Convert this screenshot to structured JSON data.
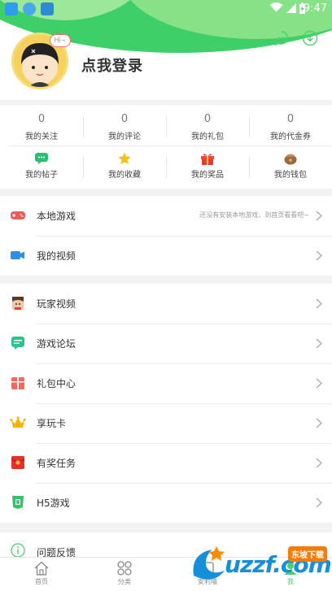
{
  "status_bar": {
    "time": "9:47"
  },
  "profile": {
    "avatar_bubble": "Hi~",
    "login_text": "点我登录"
  },
  "stats": [
    {
      "num": "0",
      "label": "我的关注"
    },
    {
      "num": "0",
      "label": "我的评论"
    },
    {
      "num": "0",
      "label": "我的礼包"
    },
    {
      "num": "0",
      "label": "我的代金券"
    }
  ],
  "quick": [
    {
      "label": "我的帖子",
      "icon": "chat-bubble-icon"
    },
    {
      "label": "我的收藏",
      "icon": "star-icon"
    },
    {
      "label": "我的奖品",
      "icon": "gift-icon"
    },
    {
      "label": "我的钱包",
      "icon": "wallet-icon"
    }
  ],
  "group1": [
    {
      "label": "本地游戏",
      "hint": "还没有安装本地游戏，到首页看看吧~",
      "icon": "gamepad-icon"
    },
    {
      "label": "我的视频",
      "hint": "",
      "icon": "video-camera-icon"
    }
  ],
  "group2": [
    {
      "label": "玩家视频",
      "icon": "player-avatar-icon"
    },
    {
      "label": "游戏论坛",
      "icon": "forum-icon"
    },
    {
      "label": "礼包中心",
      "icon": "gift-box-icon"
    },
    {
      "label": "享玩卡",
      "icon": "crown-icon"
    },
    {
      "label": "有奖任务",
      "icon": "red-envelope-icon"
    },
    {
      "label": "H5游戏",
      "icon": "h5-icon"
    }
  ],
  "group3": [
    {
      "label": "问题反馈",
      "icon": "info-icon"
    }
  ],
  "bottom_nav": [
    {
      "label": "首页",
      "icon": "home-icon"
    },
    {
      "label": "分类",
      "icon": "category-icon"
    },
    {
      "label": "安利墙",
      "icon": "wall-icon"
    },
    {
      "label": "我",
      "icon": "me-icon",
      "active": true
    }
  ],
  "watermark": {
    "text": "uzzf.com",
    "badge": "东坡下载"
  },
  "colors": {
    "accent": "#4ccf6e",
    "header_green": "#3fcf68"
  }
}
